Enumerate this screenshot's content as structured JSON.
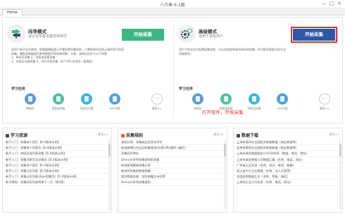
{
  "window": {
    "title": "八爪鱼 6.1版",
    "controls": [
      "—",
      "□",
      "×"
    ]
  },
  "tabs": [
    {
      "label": "Home"
    }
  ],
  "wizard": {
    "title": "向导模式",
    "subtitle": "适合初学者采集简单网页",
    "button": "开始采集",
    "description": [
      "适用于新手初次使用，即根据模板提示步骤设置采集规则，只需依照向导提示操作即可完成",
      "采集。模板须根据提供参考数据不同场景调整，方便。该模式适合于以下场景",
      "1、单网页采集          2、列表或表格采集",
      "3、列表及详情采集      4、URL列表采集（多个URL共用同一套规则）"
    ],
    "tasks_title": "学习任务",
    "tasks": [
      "单网页",
      "列表或表格",
      "列表及详情",
      "URL列表",
      "更多>>"
    ]
  },
  "advanced": {
    "title": "高级模式",
    "subtitle": "适用于高级用户",
    "button": "开始采集",
    "description": [
      "用户可完全自主配置采集流程，可以实现各种复杂网站的采集，并可配合智能识别节点",
      "功能使用。"
    ],
    "tasks_title": "学习任务",
    "tasks": [
      "单网页",
      "列表或表格",
      "列表及详情",
      "URL列表",
      "更多>>"
    ]
  },
  "annotation": "打开软件，开始采集",
  "sections": [
    {
      "title": "学习资源",
      "more": "更多>>",
      "items": [
        "新手入门：采集单个网页【6.X版本示例】",
        "新手入门：采集单个列表页【6.X版本示例】",
        "新手入门：单网页或列表采集【6.X版本示例】",
        "新手入门：采集列表页及详情页【6.X版本示例】",
        "新手入门：采集多个网页【6.X版本示例】",
        "新手入门：采集分页列表【6.X版本示例】",
        "新手入门：采集分页列表(Ajax型翻页)【6.X版本示例】",
        "新手教程：采集网页列表附带下一页（第2版）"
      ]
    },
    {
      "title": "采集规则",
      "more": "更多>>",
      "items": [
        "规程分享：采集商品信息及评价",
        "新浪微博公共自动采集规则(列表/URL循环+翻页)",
        "采集网页地址",
        "Demo分享到采集规则前采集",
        "新浪新闻数据采集分享",
        "新浪网采集前数据采集",
        "国学数据合集：国学典籍古诗词等",
        "Demo分享到采集规则"
      ]
    },
    {
      "title": "数据下载",
      "more": "更多>>",
      "items": [
        "上海市第四次全国经济普查数据（商业数据等）",
        "北京市第四次全国经济普查数据（商业数据等）",
        "上海市政务数据服务公司1000家（数据、电话、地址）",
        "上海市政务数据公司数据汇编（名称、电话、网址）",
        "广东省企业名录（名称、地址、电话、邮箱）",
        "浙江省中小企业数据（名称、法人代表等）",
        "全国医院数据汇总（名称、等级、电话）",
        "上海市企业公司名录（名称、电话、网址）"
      ]
    }
  ],
  "colors": {
    "green_button": "#3ab883",
    "blue_button": "#2f57a7",
    "highlight": "#e0332f",
    "task_icons": [
      "#5b9bd5",
      "#49c3a1",
      "#39b6e0",
      "#4aa3df"
    ]
  }
}
